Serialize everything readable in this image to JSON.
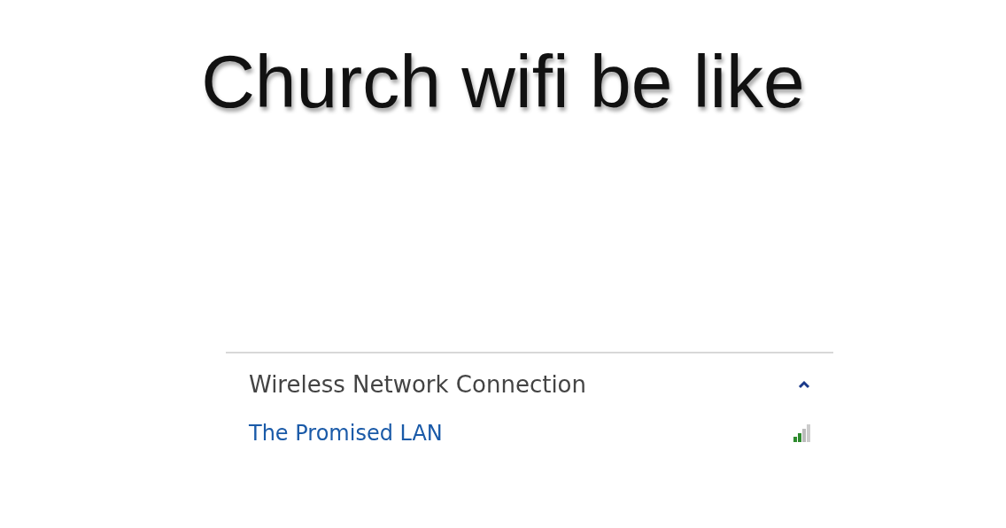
{
  "caption": "Church wifi be like",
  "network_panel": {
    "section": {
      "title": "Wireless Network Connection",
      "expanded": true
    },
    "networks": [
      {
        "name": "The Promised LAN"
      }
    ]
  }
}
